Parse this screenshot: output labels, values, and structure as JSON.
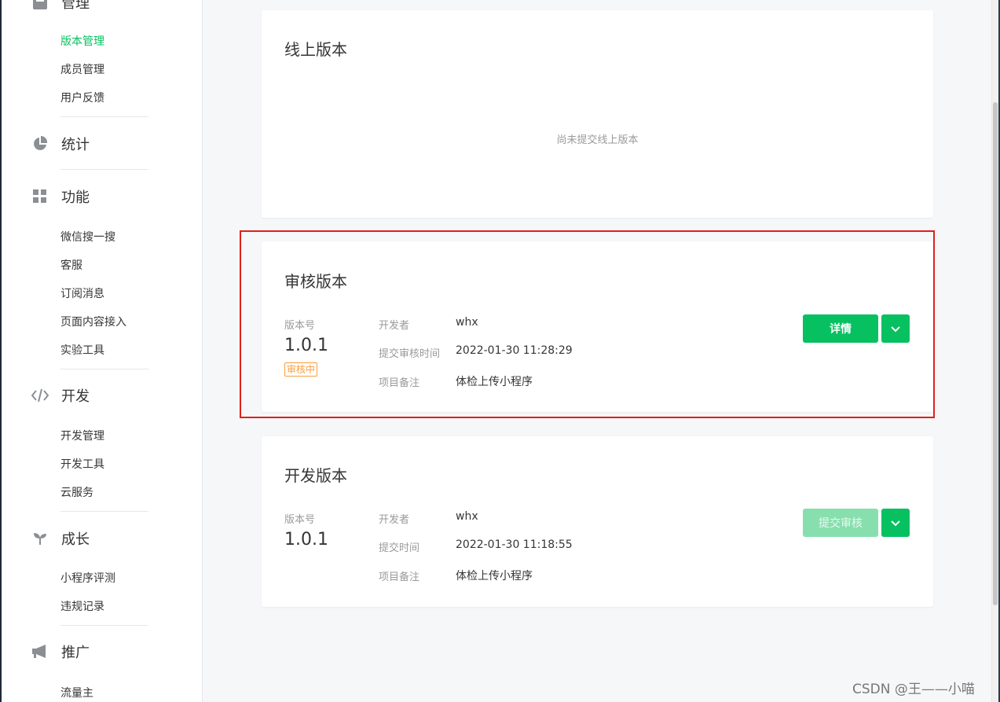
{
  "sidebar": {
    "manage": {
      "title": "管理",
      "items": [
        "版本管理",
        "成员管理",
        "用户反馈"
      ]
    },
    "stats": {
      "title": "统计"
    },
    "features": {
      "title": "功能",
      "items": [
        "微信搜一搜",
        "客服",
        "订阅消息",
        "页面内容接入",
        "实验工具"
      ]
    },
    "develop": {
      "title": "开发",
      "items": [
        "开发管理",
        "开发工具",
        "云服务"
      ]
    },
    "growth": {
      "title": "成长",
      "items": [
        "小程序评测",
        "违规记录"
      ]
    },
    "promote": {
      "title": "推广",
      "items": [
        "流量主"
      ]
    },
    "active_item": "版本管理"
  },
  "online": {
    "title": "线上版本",
    "empty_text": "尚未提交线上版本"
  },
  "review": {
    "title": "审核版本",
    "version_label": "版本号",
    "version": "1.0.1",
    "status": "审核中",
    "developer_label": "开发者",
    "developer": "whx",
    "time_label": "提交审核时间",
    "time": "2022-01-30 11:28:29",
    "note_label": "项目备注",
    "note": "体检上传小程序",
    "detail_button": "详情"
  },
  "dev": {
    "title": "开发版本",
    "version_label": "版本号",
    "version": "1.0.1",
    "developer_label": "开发者",
    "developer": "whx",
    "time_label": "提交时间",
    "time": "2022-01-30 11:18:55",
    "note_label": "项目备注",
    "note": "体检上传小程序",
    "submit_button": "提交审核"
  },
  "watermark": "CSDN @王——小喵",
  "colors": {
    "brand_green": "#07c160",
    "disabled_green": "#87dfae",
    "status_orange": "#fa9d3b",
    "highlight_red": "#e0201c"
  },
  "icons": {
    "manage": "manage-icon",
    "stats": "pie-chart-icon",
    "features": "grid-icon",
    "develop": "code-icon",
    "growth": "sprout-icon",
    "promote": "megaphone-icon",
    "dropdown": "chevron-down-icon"
  }
}
